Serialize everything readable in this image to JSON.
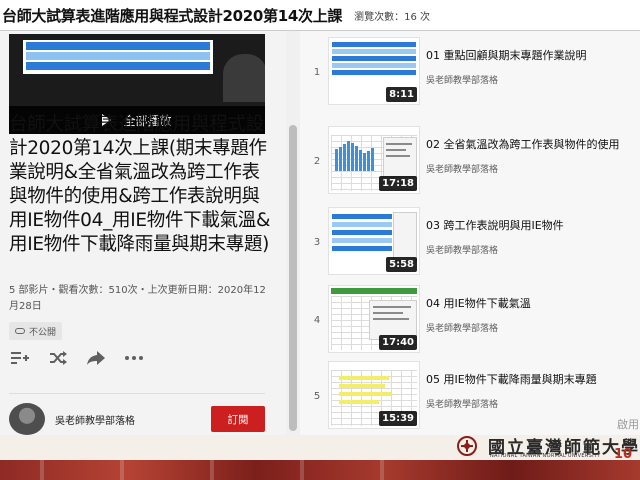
{
  "header": {
    "slide_title": "台師大試算表進階應用與程式設計2020第14次上課",
    "view_count": "瀏覽次數：16 次"
  },
  "playlist": {
    "play_all_label": "全部播放",
    "title": "台師大試算表進階應用與程式設計2020第14次上課(期末專題作業說明&全省氣溫改為跨工作表與物件的使用&跨工作表說明與用IE物件04_用IE物件下載氣溫&用IE物件下載降雨量與期末專題)",
    "stats_line": "5 部影片・觀看次數：510次・上次更新日期：2020年12月28日",
    "privacy_label": "不公開",
    "channel_name": "吳老師教學部落格",
    "subscribe_label": "訂閱"
  },
  "actions": {
    "add_to_queue_icon": "playlist-add-icon",
    "shuffle_icon": "shuffle-icon",
    "share_icon": "share-icon",
    "more_icon": "more-horizontal-icon"
  },
  "videos": [
    {
      "index": "1",
      "title": "01 重點回顧與期末專題作業說明",
      "channel": "吳老師教學部落格",
      "duration": "8:11"
    },
    {
      "index": "2",
      "title": "02 全省氣溫改為跨工作表與物件的使用",
      "channel": "吳老師教學部落格",
      "duration": "17:18"
    },
    {
      "index": "3",
      "title": "03 跨工作表說明與用IE物件",
      "channel": "吳老師教學部落格",
      "duration": "5:58"
    },
    {
      "index": "4",
      "title": "04 用IE物件下載氣溫",
      "channel": "吳老師教學部落格",
      "duration": "17:40"
    },
    {
      "index": "5",
      "title": "05 用IE物件下載降雨量與期末專題",
      "channel": "吳老師教學部落格",
      "duration": "15:39"
    }
  ],
  "banner": {
    "university_name": "國立臺灣師範大學",
    "university_name_en": "NATIONAL TAIWAN NORMAL UNIVERSITY",
    "watermark": "啟用",
    "page_number": "10"
  },
  "colors": {
    "subscribe_red": "#cc1f1f",
    "page_number_red": "#c12a1a",
    "sheet_blue": "#2b7bd6"
  }
}
